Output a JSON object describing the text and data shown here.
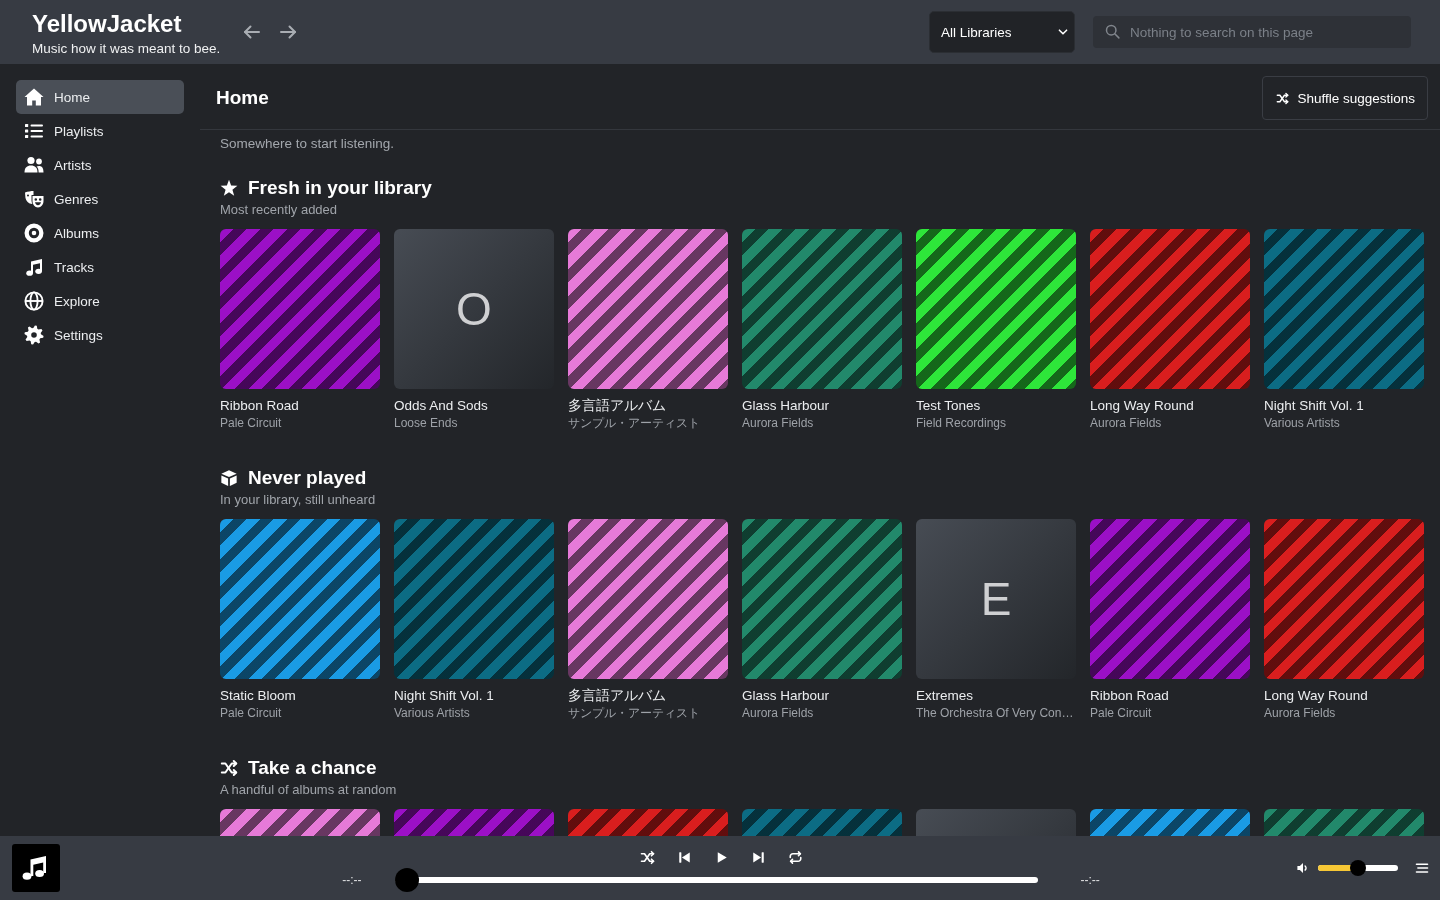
{
  "app": {
    "name": "YellowJacket",
    "tagline": "Music how it was meant to bee."
  },
  "header": {
    "library_select": {
      "value": "All Libraries"
    },
    "search": {
      "placeholder": "Nothing to search on this page"
    }
  },
  "sidebar": {
    "items": [
      {
        "label": "Home",
        "selected": true
      },
      {
        "label": "Playlists",
        "selected": false
      },
      {
        "label": "Artists",
        "selected": false
      },
      {
        "label": "Genres",
        "selected": false
      },
      {
        "label": "Albums",
        "selected": false
      },
      {
        "label": "Tracks",
        "selected": false
      },
      {
        "label": "Explore",
        "selected": false
      },
      {
        "label": "Settings",
        "selected": false
      }
    ]
  },
  "page": {
    "title": "Home",
    "action": "Shuffle suggestions",
    "intro": "Somewhere to start listening."
  },
  "sections": [
    {
      "title": "Fresh in your library",
      "subtitle": "Most recently added",
      "albums": [
        {
          "kind": "stripes",
          "color": "#9b10c6",
          "title": "Ribbon Road",
          "artist": "Pale Circuit"
        },
        {
          "kind": "letter",
          "letter": "O",
          "title": "Odds And Sods",
          "artist": "Loose Ends"
        },
        {
          "kind": "stripes",
          "color": "#e67ad8",
          "title": "多言語アルバム",
          "artist": "サンプル・アーティスト"
        },
        {
          "kind": "stripes",
          "color": "#22896b",
          "title": "Glass Harbour",
          "artist": "Aurora Fields"
        },
        {
          "kind": "stripes",
          "color": "#2ee63a",
          "title": "Test Tones",
          "artist": "Field Recordings"
        },
        {
          "kind": "stripes",
          "color": "#d91e1e",
          "title": "Long Way Round",
          "artist": "Aurora Fields"
        },
        {
          "kind": "stripes",
          "color": "#0c6c84",
          "title": "Night Shift Vol. 1",
          "artist": "Various Artists"
        }
      ]
    },
    {
      "title": "Never played",
      "subtitle": "In your library, still unheard",
      "albums": [
        {
          "kind": "stripes",
          "color": "#1a9be4",
          "title": "Static Bloom",
          "artist": "Pale Circuit"
        },
        {
          "kind": "stripes",
          "color": "#0c6c84",
          "title": "Night Shift Vol. 1",
          "artist": "Various Artists"
        },
        {
          "kind": "stripes",
          "color": "#e67ad8",
          "title": "多言語アルバム",
          "artist": "サンプル・アーティスト"
        },
        {
          "kind": "stripes",
          "color": "#22896b",
          "title": "Glass Harbour",
          "artist": "Aurora Fields"
        },
        {
          "kind": "letter",
          "letter": "E",
          "title": "Extremes",
          "artist": "The Orchestra Of Very Con…"
        },
        {
          "kind": "stripes",
          "color": "#9b10c6",
          "title": "Ribbon Road",
          "artist": "Pale Circuit"
        },
        {
          "kind": "stripes",
          "color": "#d91e1e",
          "title": "Long Way Round",
          "artist": "Aurora Fields"
        }
      ]
    },
    {
      "title": "Take a chance",
      "subtitle": "A handful of albums at random",
      "albums": [
        {
          "kind": "stripes",
          "color": "#e67ad8"
        },
        {
          "kind": "stripes",
          "color": "#9b10c6"
        },
        {
          "kind": "stripes",
          "color": "#d91e1e"
        },
        {
          "kind": "stripes",
          "color": "#0c6c84"
        },
        {
          "kind": "letter"
        },
        {
          "kind": "stripes",
          "color": "#1a9be4"
        },
        {
          "kind": "stripes",
          "color": "#22896b"
        }
      ]
    }
  ],
  "player": {
    "elapsed": "--:--",
    "progress": {
      "level": 0
    },
    "remaining": "--:--",
    "volume": {
      "level": 0.5
    }
  }
}
